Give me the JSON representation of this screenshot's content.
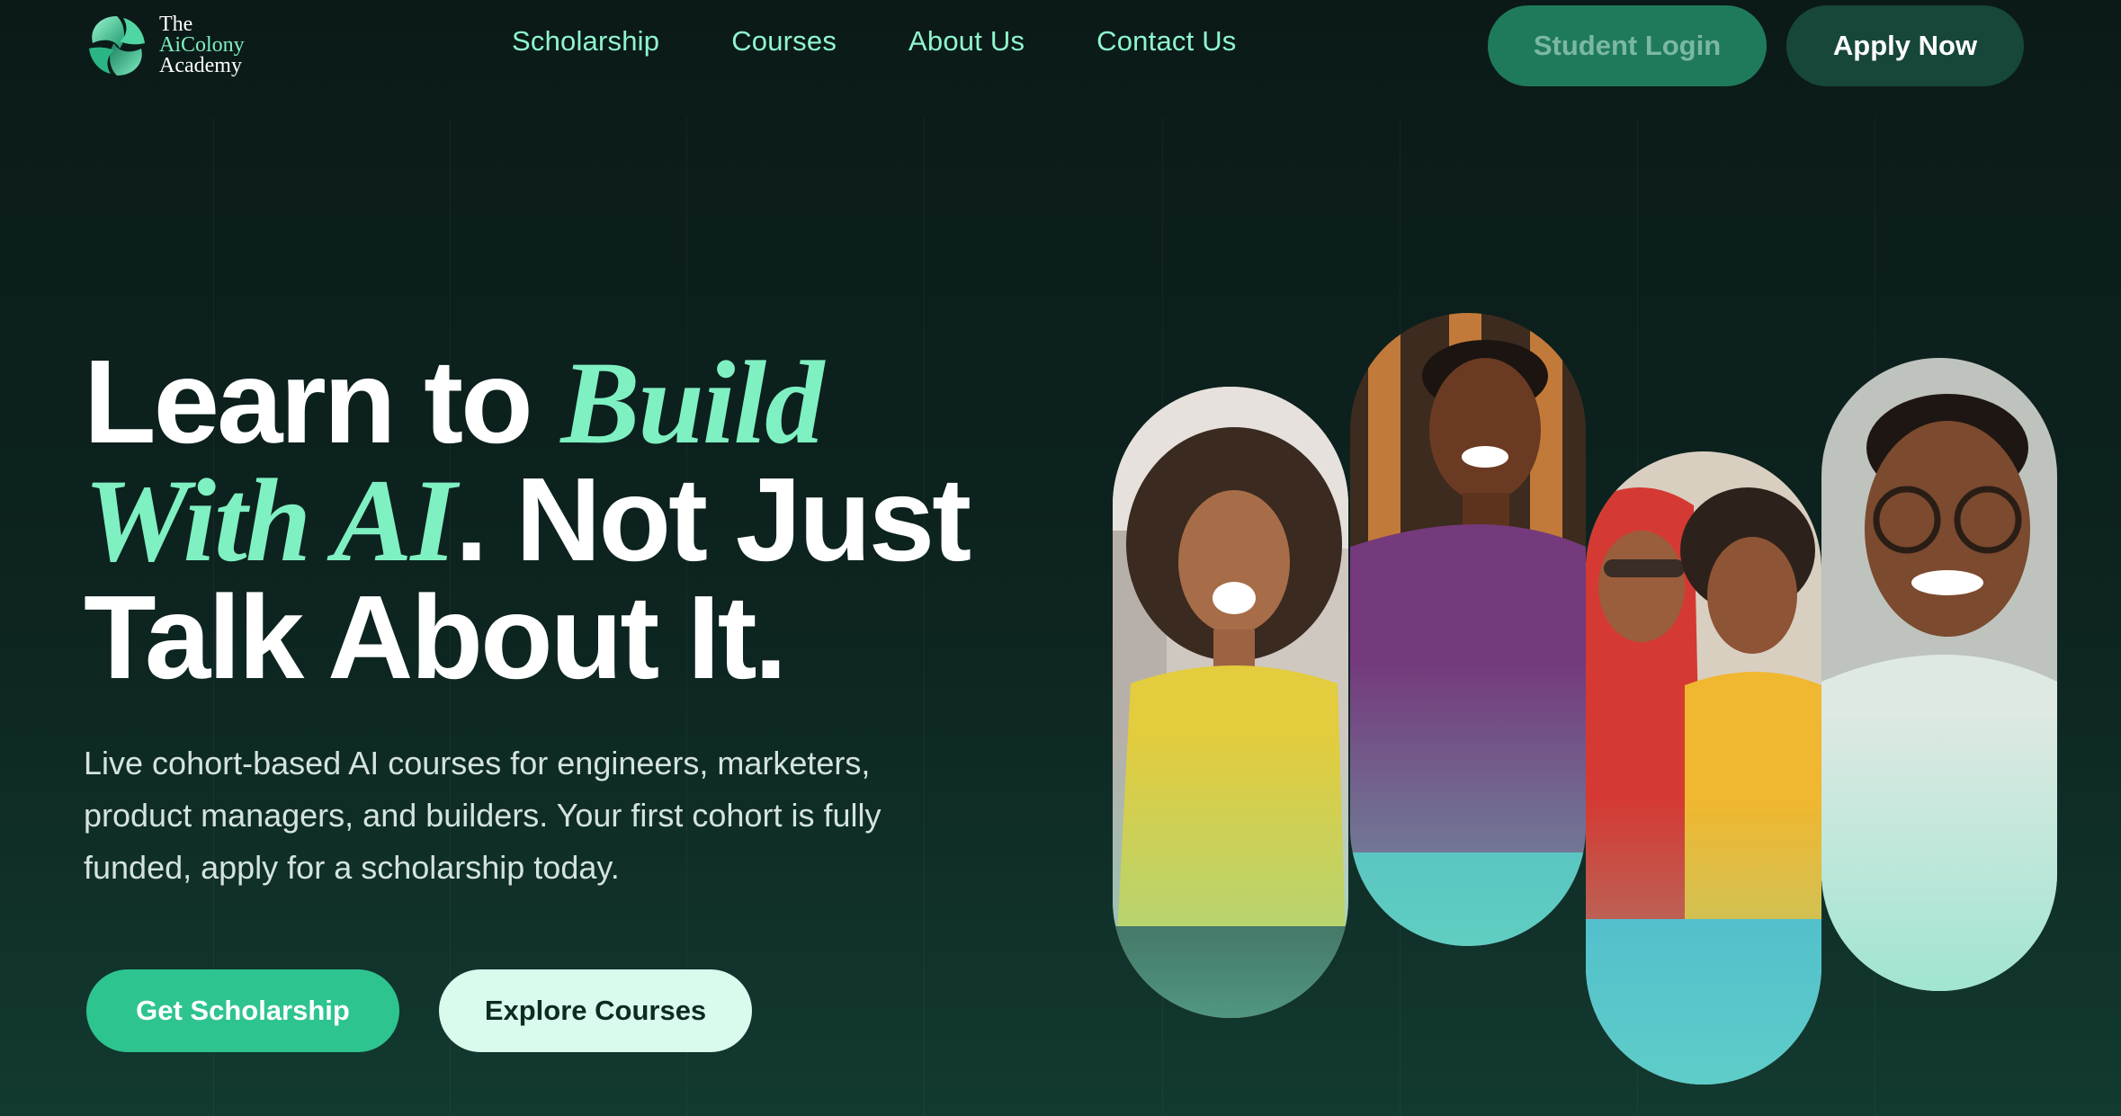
{
  "brand": {
    "name_lines": [
      "The",
      "AiColony",
      "Academy"
    ],
    "logo_icon": "interlocking-leaf-logo-icon"
  },
  "nav": {
    "items": [
      "Scholarship",
      "Courses",
      "About Us",
      "Contact Us"
    ]
  },
  "header_actions": {
    "login_label": "Student Login",
    "apply_label": "Apply Now"
  },
  "hero": {
    "headline": {
      "part1": "Learn to ",
      "accent1": "Build",
      "accent2": "With AI",
      "part2": ". Not Just",
      "part3": "Talk About It."
    },
    "subtext": "Live cohort-based AI courses for engineers, marketers, product managers, and builders. Your first cohort is fully funded, apply for a scholarship today.",
    "primary_cta": "Get Scholarship",
    "secondary_cta": "Explore Courses"
  },
  "photos": [
    {
      "icon": "woman-smiling-photo"
    },
    {
      "icon": "man-smiling-photo"
    },
    {
      "icon": "two-women-laptop-photo"
    },
    {
      "icon": "man-glasses-photo"
    }
  ],
  "colors": {
    "accent": "#7ff0c2",
    "primary_button": "#2ec48f",
    "secondary_button": "#d8fbee",
    "login_button": "#1f7a5c",
    "apply_button": "#17473a",
    "background": "#0b1a18"
  }
}
